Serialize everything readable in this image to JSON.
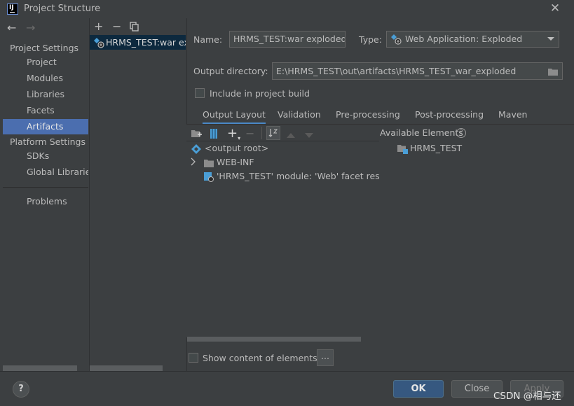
{
  "window": {
    "title": "Project Structure",
    "close_glyph": "✕"
  },
  "left_nav": {
    "back_glyph": "←",
    "forward_glyph": "→",
    "project_settings_header": "Project Settings",
    "project_items": [
      {
        "label": "Project"
      },
      {
        "label": "Modules"
      },
      {
        "label": "Libraries"
      },
      {
        "label": "Facets"
      },
      {
        "label": "Artifacts",
        "selected": true
      }
    ],
    "platform_settings_header": "Platform Settings",
    "platform_items": [
      {
        "label": "SDKs"
      },
      {
        "label": "Global Libraries"
      }
    ],
    "problems_label": "Problems"
  },
  "artifacts": {
    "add_glyph": "+",
    "remove_glyph": "−",
    "copy_icon": "copy-icon",
    "items": [
      {
        "label": "HRMS_TEST:war exploded",
        "icon": "web-artifact-icon"
      }
    ]
  },
  "details": {
    "name_label": "Name:",
    "name_value": "HRMS_TEST:war exploded",
    "type_label": "Type:",
    "type_value": "Web Application: Exploded",
    "output_dir_label": "Output directory:",
    "output_dir_value": "E:\\HRMS_TEST\\out\\artifacts\\HRMS_TEST_war_exploded",
    "include_in_build_label": "Include in project build",
    "include_in_build_checked": false
  },
  "tabs": [
    {
      "label": "Output Layout",
      "active": true
    },
    {
      "label": "Validation"
    },
    {
      "label": "Pre-processing"
    },
    {
      "label": "Post-processing"
    },
    {
      "label": "Maven"
    }
  ],
  "layout_tree": {
    "rows": [
      {
        "label": "<output root>",
        "icon": "output-root-icon"
      },
      {
        "label": "WEB-INF",
        "icon": "folder-icon",
        "expandable": true
      },
      {
        "label": "'HRMS_TEST' module: 'Web' facet resou",
        "icon": "module-resource-icon"
      }
    ]
  },
  "available": {
    "label": "Available Elements",
    "help_glyph": "?",
    "items": [
      {
        "label": "HRMS_TEST",
        "icon": "module-folder-icon"
      }
    ]
  },
  "show_content_label": "Show content of elements",
  "show_content_checked": false,
  "ellipsis_label": "...",
  "buttons": {
    "help": "?",
    "ok": "OK",
    "close": "Close",
    "apply": "Apply"
  },
  "watermark": "CSDN @相与还",
  "colors": {
    "background": "#3c3f41",
    "selection": "#4b6eaf",
    "active_tab_underline": "#4a88c7",
    "ok_button": "#365880"
  }
}
